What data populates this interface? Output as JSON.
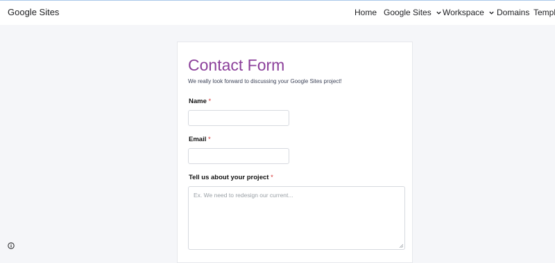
{
  "header": {
    "brand": "Google Sites",
    "nav": [
      {
        "label": "Home"
      },
      {
        "label": "Google Sites"
      },
      {
        "label": "Workspace"
      },
      {
        "label": "Domains"
      },
      {
        "label": "Templ"
      }
    ]
  },
  "form": {
    "title": "Contact Form",
    "subtitle": "We really look forward to discussing your Google Sites project!",
    "fields": [
      {
        "label": "Name",
        "required_mark": "*",
        "value": ""
      },
      {
        "label": "Email",
        "required_mark": "*",
        "value": ""
      },
      {
        "label": "Tell us about your project",
        "required_mark": "*",
        "placeholder": "Ex. We need to redesign our current..."
      }
    ]
  },
  "icons": {
    "chevron": "chevron-down-icon",
    "info": "info-icon",
    "resize": "resize-handle-icon"
  }
}
